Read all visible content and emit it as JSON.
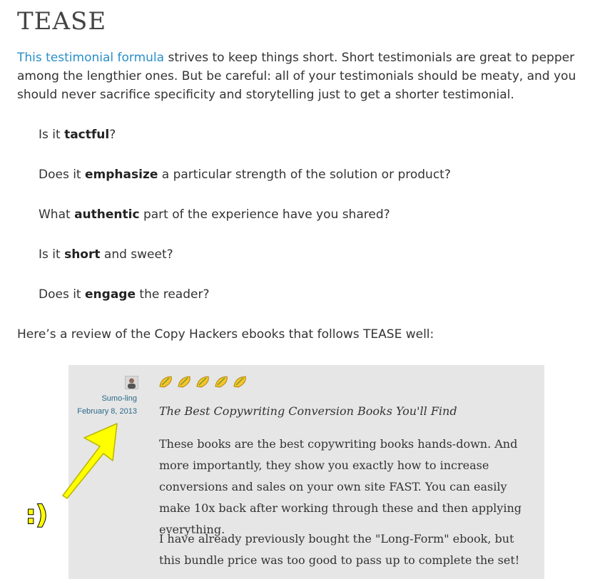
{
  "heading": "TEASE",
  "intro": {
    "link_text": "This testimonial formula",
    "rest": " strives to keep things short. Short testimonials are great to pepper among the lengthier ones. But be careful: all of your testimonials should be meaty, and you should never sacrifice specificity and storytelling just to get a shorter testimonial."
  },
  "questions": [
    {
      "before": "Is it ",
      "bold": "tactful",
      "after": "?"
    },
    {
      "before": "Does it ",
      "bold": "emphasize",
      "after": " a particular strength of the solution or product?"
    },
    {
      "before": "What ",
      "bold": "authentic",
      "after": " part of the experience have you shared?"
    },
    {
      "before": "Is it ",
      "bold": "short",
      "after": " and sweet?"
    },
    {
      "before": "Does it ",
      "bold": "engage",
      "after": " the reader?"
    }
  ],
  "outro": "Here’s a review of the Copy Hackers ebooks that follows TEASE well:",
  "review": {
    "reviewer_name": "Sumo-ling",
    "date": "February 8, 2013",
    "rating": 5,
    "star_icon": "taco-icon",
    "title": "The Best Copywriting Conversion Books You'll Find",
    "body": [
      "These books are the best copywriting books hands-down. And more importantly, they show you exactly how to increase conversions and sales on your own site FAST. You can easily make 10x back after working through these and then applying everything.",
      "I have already previously bought the \"Long-Form\" ebook, but this bundle price was too good to pass up to complete the set!"
    ]
  },
  "annotation": {
    "emoticon": ":)",
    "arrow_color": "#ffff00"
  }
}
